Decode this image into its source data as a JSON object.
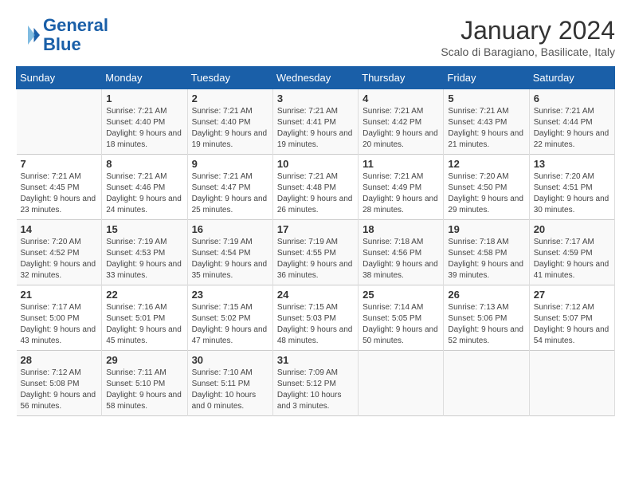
{
  "header": {
    "logo_line1": "General",
    "logo_line2": "Blue",
    "month": "January 2024",
    "location": "Scalo di Baragiano, Basilicate, Italy"
  },
  "days_of_week": [
    "Sunday",
    "Monday",
    "Tuesday",
    "Wednesday",
    "Thursday",
    "Friday",
    "Saturday"
  ],
  "weeks": [
    [
      {
        "num": "",
        "sunrise": "",
        "sunset": "",
        "daylight": ""
      },
      {
        "num": "1",
        "sunrise": "7:21 AM",
        "sunset": "4:40 PM",
        "daylight": "9 hours and 18 minutes."
      },
      {
        "num": "2",
        "sunrise": "7:21 AM",
        "sunset": "4:40 PM",
        "daylight": "9 hours and 19 minutes."
      },
      {
        "num": "3",
        "sunrise": "7:21 AM",
        "sunset": "4:41 PM",
        "daylight": "9 hours and 19 minutes."
      },
      {
        "num": "4",
        "sunrise": "7:21 AM",
        "sunset": "4:42 PM",
        "daylight": "9 hours and 20 minutes."
      },
      {
        "num": "5",
        "sunrise": "7:21 AM",
        "sunset": "4:43 PM",
        "daylight": "9 hours and 21 minutes."
      },
      {
        "num": "6",
        "sunrise": "7:21 AM",
        "sunset": "4:44 PM",
        "daylight": "9 hours and 22 minutes."
      }
    ],
    [
      {
        "num": "7",
        "sunrise": "7:21 AM",
        "sunset": "4:45 PM",
        "daylight": "9 hours and 23 minutes."
      },
      {
        "num": "8",
        "sunrise": "7:21 AM",
        "sunset": "4:46 PM",
        "daylight": "9 hours and 24 minutes."
      },
      {
        "num": "9",
        "sunrise": "7:21 AM",
        "sunset": "4:47 PM",
        "daylight": "9 hours and 25 minutes."
      },
      {
        "num": "10",
        "sunrise": "7:21 AM",
        "sunset": "4:48 PM",
        "daylight": "9 hours and 26 minutes."
      },
      {
        "num": "11",
        "sunrise": "7:21 AM",
        "sunset": "4:49 PM",
        "daylight": "9 hours and 28 minutes."
      },
      {
        "num": "12",
        "sunrise": "7:20 AM",
        "sunset": "4:50 PM",
        "daylight": "9 hours and 29 minutes."
      },
      {
        "num": "13",
        "sunrise": "7:20 AM",
        "sunset": "4:51 PM",
        "daylight": "9 hours and 30 minutes."
      }
    ],
    [
      {
        "num": "14",
        "sunrise": "7:20 AM",
        "sunset": "4:52 PM",
        "daylight": "9 hours and 32 minutes."
      },
      {
        "num": "15",
        "sunrise": "7:19 AM",
        "sunset": "4:53 PM",
        "daylight": "9 hours and 33 minutes."
      },
      {
        "num": "16",
        "sunrise": "7:19 AM",
        "sunset": "4:54 PM",
        "daylight": "9 hours and 35 minutes."
      },
      {
        "num": "17",
        "sunrise": "7:19 AM",
        "sunset": "4:55 PM",
        "daylight": "9 hours and 36 minutes."
      },
      {
        "num": "18",
        "sunrise": "7:18 AM",
        "sunset": "4:56 PM",
        "daylight": "9 hours and 38 minutes."
      },
      {
        "num": "19",
        "sunrise": "7:18 AM",
        "sunset": "4:58 PM",
        "daylight": "9 hours and 39 minutes."
      },
      {
        "num": "20",
        "sunrise": "7:17 AM",
        "sunset": "4:59 PM",
        "daylight": "9 hours and 41 minutes."
      }
    ],
    [
      {
        "num": "21",
        "sunrise": "7:17 AM",
        "sunset": "5:00 PM",
        "daylight": "9 hours and 43 minutes."
      },
      {
        "num": "22",
        "sunrise": "7:16 AM",
        "sunset": "5:01 PM",
        "daylight": "9 hours and 45 minutes."
      },
      {
        "num": "23",
        "sunrise": "7:15 AM",
        "sunset": "5:02 PM",
        "daylight": "9 hours and 47 minutes."
      },
      {
        "num": "24",
        "sunrise": "7:15 AM",
        "sunset": "5:03 PM",
        "daylight": "9 hours and 48 minutes."
      },
      {
        "num": "25",
        "sunrise": "7:14 AM",
        "sunset": "5:05 PM",
        "daylight": "9 hours and 50 minutes."
      },
      {
        "num": "26",
        "sunrise": "7:13 AM",
        "sunset": "5:06 PM",
        "daylight": "9 hours and 52 minutes."
      },
      {
        "num": "27",
        "sunrise": "7:12 AM",
        "sunset": "5:07 PM",
        "daylight": "9 hours and 54 minutes."
      }
    ],
    [
      {
        "num": "28",
        "sunrise": "7:12 AM",
        "sunset": "5:08 PM",
        "daylight": "9 hours and 56 minutes."
      },
      {
        "num": "29",
        "sunrise": "7:11 AM",
        "sunset": "5:10 PM",
        "daylight": "9 hours and 58 minutes."
      },
      {
        "num": "30",
        "sunrise": "7:10 AM",
        "sunset": "5:11 PM",
        "daylight": "10 hours and 0 minutes."
      },
      {
        "num": "31",
        "sunrise": "7:09 AM",
        "sunset": "5:12 PM",
        "daylight": "10 hours and 3 minutes."
      },
      {
        "num": "",
        "sunrise": "",
        "sunset": "",
        "daylight": ""
      },
      {
        "num": "",
        "sunrise": "",
        "sunset": "",
        "daylight": ""
      },
      {
        "num": "",
        "sunrise": "",
        "sunset": "",
        "daylight": ""
      }
    ]
  ],
  "labels": {
    "sunrise": "Sunrise:",
    "sunset": "Sunset:",
    "daylight": "Daylight:"
  }
}
